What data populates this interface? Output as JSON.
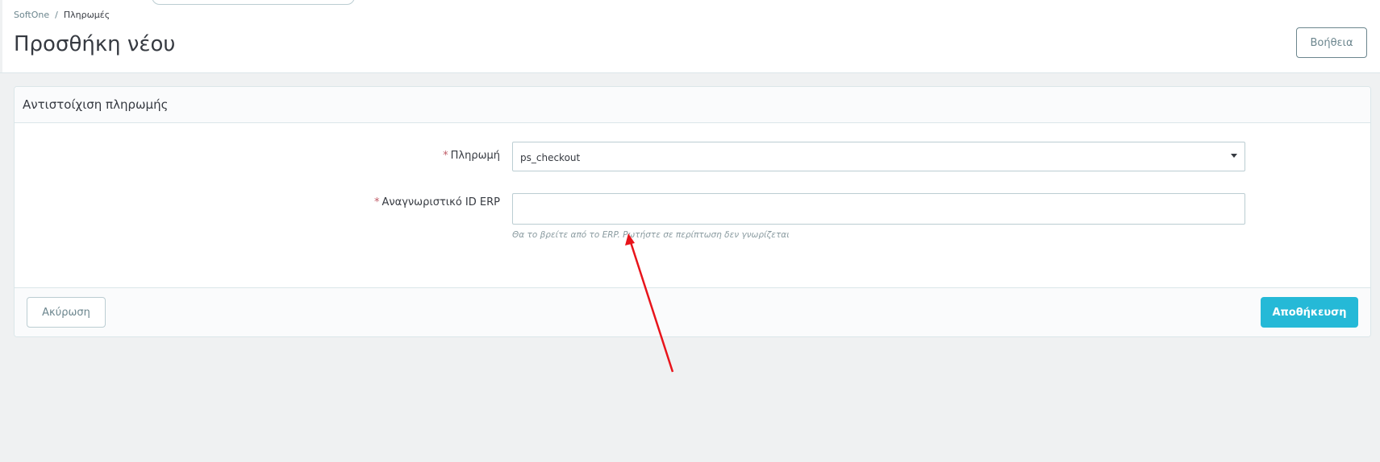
{
  "breadcrumb": {
    "root": "SoftOne",
    "separator": "/",
    "current": "Πληρωμές"
  },
  "header": {
    "title": "Προσθήκη νέου",
    "help_label": "Βοήθεια"
  },
  "panel": {
    "title": "Αντιστοίχιση πληρωμής",
    "fields": {
      "payment": {
        "required_mark": "*",
        "label": "Πληρωμή",
        "value": "ps_checkout"
      },
      "erp_id": {
        "required_mark": "*",
        "label": "Αναγνωριστικό ID ERP",
        "value": "",
        "hint": "Θα το βρείτε από το ERP. Ρωτήστε σε περίπτωση δεν γνωρίζεται"
      }
    },
    "footer": {
      "cancel_label": "Ακύρωση",
      "save_label": "Αποθήκευση"
    }
  },
  "colors": {
    "accent": "#25b9d7",
    "required": "#c05c67",
    "annotation_arrow": "#e8141b"
  },
  "icons": {
    "select_caret": "caret-down-icon"
  }
}
